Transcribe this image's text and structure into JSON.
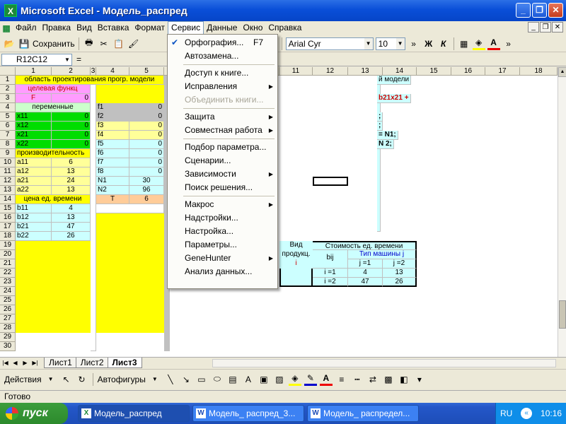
{
  "window": {
    "title": "Microsoft Excel - Модель_распред",
    "buttons": [
      "_",
      "❐",
      "✕"
    ]
  },
  "menubar": {
    "items": [
      "Файл",
      "Правка",
      "Вид",
      "Вставка",
      "Формат",
      "Сервис",
      "Данные",
      "Окно",
      "Справка"
    ],
    "active": "Сервис"
  },
  "mdi_buttons": [
    "_",
    "❐",
    "✕"
  ],
  "toolbar": {
    "save_label": "Сохранить",
    "font": "Arial Cyr",
    "size": "10",
    "bold": "Ж",
    "italic": "К"
  },
  "formula": {
    "namebox": "R12C12",
    "fx": "="
  },
  "columns": [
    {
      "label": "",
      "w": 22
    },
    {
      "label": "1",
      "w": 51
    },
    {
      "label": "2",
      "w": 55
    },
    {
      "label": "3",
      "w": 8
    },
    {
      "label": "4",
      "w": 47
    },
    {
      "label": "5",
      "w": 49
    },
    {
      "label": "",
      "w": 163
    },
    {
      "label": "11",
      "w": 47
    },
    {
      "label": "12",
      "w": 50
    },
    {
      "label": "13",
      "w": 49
    },
    {
      "label": "14",
      "w": 48
    },
    {
      "label": "15",
      "w": 49
    },
    {
      "label": "16",
      "w": 48
    },
    {
      "label": "17",
      "w": 49
    },
    {
      "label": "18",
      "w": 53
    }
  ],
  "rows": [
    "1",
    "2",
    "3",
    "4",
    "5",
    "6",
    "7",
    "8",
    "9",
    "10",
    "11",
    "12",
    "13",
    "14",
    "15",
    "16",
    "17",
    "18",
    "19",
    "20",
    "21",
    "22",
    "23",
    "24",
    "25",
    "26",
    "27",
    "28",
    "29",
    "30"
  ],
  "left_block": {
    "header": "область проектирования прогр. модели",
    "target_label": "целевая функц",
    "target_name": "F",
    "target_value": "0",
    "vars_label": "переменные",
    "vars": [
      {
        "n": "x11",
        "v": "0"
      },
      {
        "n": "x12",
        "v": "0"
      },
      {
        "n": "x21",
        "v": "0"
      },
      {
        "n": "x22",
        "v": "0"
      }
    ],
    "prod_label": "производительность",
    "prod": [
      {
        "n": "a11",
        "v": "6"
      },
      {
        "n": "a12",
        "v": "13"
      },
      {
        "n": "a21",
        "v": "24"
      },
      {
        "n": "a22",
        "v": "13"
      }
    ],
    "cost_label": "цена ед. времени",
    "cost": [
      {
        "n": "b11",
        "v": "4"
      },
      {
        "n": "b12",
        "v": "13"
      },
      {
        "n": "b21",
        "v": "47"
      },
      {
        "n": "b22",
        "v": "26"
      }
    ],
    "f_list": [
      {
        "n": "f1",
        "v": "0"
      },
      {
        "n": "f2",
        "v": "0"
      },
      {
        "n": "f3",
        "v": "0"
      },
      {
        "n": "f4",
        "v": "0"
      },
      {
        "n": "f5",
        "v": "0"
      },
      {
        "n": "f6",
        "v": "0"
      },
      {
        "n": "f7",
        "v": "0"
      },
      {
        "n": "f8",
        "v": "0"
      }
    ],
    "n_list": [
      {
        "n": "N1",
        "v": "30"
      },
      {
        "n": "N2",
        "v": "96"
      },
      {
        "n": "T",
        "v": "6"
      }
    ]
  },
  "right_block": {
    "header": "й модели",
    "formula_line": "b21x21 +",
    "lines": [
      ";",
      ";",
      "= N1;",
      "N 2;"
    ]
  },
  "cost_table": {
    "vid_label": "Вид",
    "vid_label2": "продукц.",
    "vid_i": "i",
    "title": "Стоимость ед. времени",
    "bij": "bij",
    "machine": "Тип машины j",
    "j1": "j =1",
    "j2": "j =2",
    "rows": [
      {
        "i": "i =1",
        "c1": "4",
        "c2": "13"
      },
      {
        "i": "i =2",
        "c1": "47",
        "c2": "26"
      }
    ]
  },
  "dropdown": {
    "items": [
      {
        "label": "Орфография...",
        "shortcut": "F7",
        "check": true
      },
      {
        "label": "Автозамена..."
      },
      {
        "sep": true
      },
      {
        "label": "Доступ к книге..."
      },
      {
        "label": "Исправления",
        "sub": true
      },
      {
        "label": "Объединить книги...",
        "disabled": true
      },
      {
        "sep": true
      },
      {
        "label": "Защита",
        "sub": true
      },
      {
        "label": "Совместная работа",
        "sub": true
      },
      {
        "sep": true
      },
      {
        "label": "Подбор параметра..."
      },
      {
        "label": "Сценарии..."
      },
      {
        "label": "Зависимости",
        "sub": true
      },
      {
        "label": "Поиск решения..."
      },
      {
        "sep": true
      },
      {
        "label": "Макрос",
        "sub": true
      },
      {
        "label": "Надстройки..."
      },
      {
        "label": "Настройка..."
      },
      {
        "label": "Параметры..."
      },
      {
        "label": "GeneHunter",
        "sub": true
      },
      {
        "label": "Анализ данных..."
      }
    ]
  },
  "sheets": {
    "tabs": [
      "Лист1",
      "Лист2",
      "Лист3"
    ],
    "active": "Лист3"
  },
  "drawbar": {
    "actions": "Действия",
    "autoshapes": "Автофигуры"
  },
  "status": {
    "text": "Готово"
  },
  "taskbar": {
    "start": "пуск",
    "tasks": [
      {
        "label": "Модель_распред",
        "icon": "X",
        "active": true
      },
      {
        "label": "Модель_ распред_3...",
        "icon": "W"
      },
      {
        "label": "Модель_ распредел...",
        "icon": "W"
      }
    ],
    "lang": "RU",
    "clock": "10:16"
  },
  "colors": {
    "yellow": "#ffff00",
    "green": "#00dd00",
    "pink": "#ff9cff",
    "lightyellow": "#ffff99",
    "cyan": "#ccffff",
    "grey": "#c0c0c0"
  }
}
